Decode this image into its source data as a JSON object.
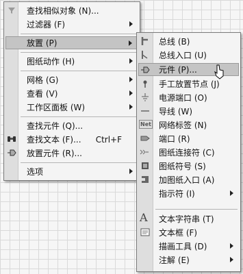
{
  "menu1": {
    "items": [
      {
        "label": "查找相似对象 (N)...",
        "sub": false
      },
      {
        "label": "过滤器 (F)",
        "sub": true
      },
      {
        "label": "放置 (P)",
        "sub": true
      },
      {
        "label": "图纸动作 (H)",
        "sub": true
      },
      {
        "label": "网格 (G)",
        "sub": true
      },
      {
        "label": "查看 (V)",
        "sub": true
      },
      {
        "label": "工作区面板 (W)",
        "sub": true
      },
      {
        "label": "查找元件 (Q)...",
        "sub": false
      },
      {
        "label": "查找文本 (F)...",
        "sub": false,
        "shortcut": "Ctrl+F"
      },
      {
        "label": "放置元件 (R)...",
        "sub": false
      },
      {
        "label": "选项",
        "sub": true
      }
    ]
  },
  "menu2": {
    "items": [
      {
        "label": "总线 (B)",
        "sub": false
      },
      {
        "label": "总线入口 (U)",
        "sub": false
      },
      {
        "label": "元件 (P)...",
        "sub": false
      },
      {
        "label": "手工放置节点 (J)",
        "sub": false
      },
      {
        "label": "电源端口 (O)",
        "sub": false
      },
      {
        "label": "导线 (W)",
        "sub": false
      },
      {
        "label": "网络标签 (N)",
        "sub": false
      },
      {
        "label": "端口 (R)",
        "sub": false
      },
      {
        "label": "图纸连接符 (C)",
        "sub": false
      },
      {
        "label": "图纸符号 (S)",
        "sub": false
      },
      {
        "label": "加图纸入口 (A)",
        "sub": false
      },
      {
        "label": "指示符 (I)",
        "sub": true
      },
      {
        "label": "文本字符串 (T)",
        "sub": false
      },
      {
        "label": "文本框 (F)",
        "sub": false
      },
      {
        "label": "描画工具 (D)",
        "sub": true
      },
      {
        "label": "注解 (E)",
        "sub": true
      }
    ]
  },
  "icons": {
    "net_label_text": "Net"
  }
}
